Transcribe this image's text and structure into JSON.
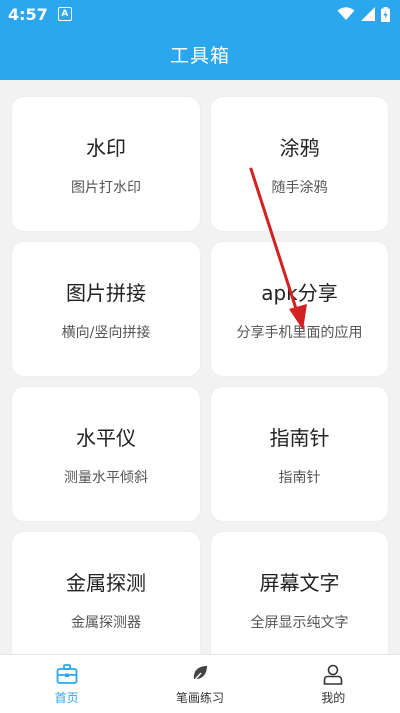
{
  "status": {
    "time": "4:57",
    "notif": "A"
  },
  "appbar": {
    "title": "工具箱"
  },
  "cards": [
    {
      "title": "水印",
      "subtitle": "图片打水印"
    },
    {
      "title": "涂鸦",
      "subtitle": "随手涂鸦"
    },
    {
      "title": "图片拼接",
      "subtitle": "横向/竖向拼接"
    },
    {
      "title": "apk分享",
      "subtitle": "分享手机里面的应用"
    },
    {
      "title": "水平仪",
      "subtitle": "测量水平倾斜"
    },
    {
      "title": "指南针",
      "subtitle": "指南针"
    },
    {
      "title": "金属探测",
      "subtitle": "金属探测器"
    },
    {
      "title": "屏幕文字",
      "subtitle": "全屏显示纯文字"
    }
  ],
  "nav": [
    {
      "label": "首页",
      "icon": "toolbox-icon",
      "active": true
    },
    {
      "label": "笔画练习",
      "icon": "leaf-icon",
      "active": false
    },
    {
      "label": "我的",
      "icon": "person-icon",
      "active": false
    }
  ],
  "colors": {
    "accent": "#2ba7ee",
    "annotation": "#d32020"
  }
}
